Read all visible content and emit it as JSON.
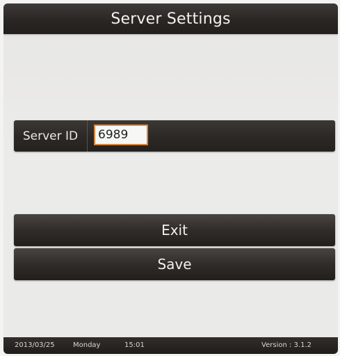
{
  "header": {
    "title": "Server Settings"
  },
  "server": {
    "label": "Server ID",
    "value": "6989"
  },
  "buttons": {
    "exit": "Exit",
    "save": "Save"
  },
  "status": {
    "date": "2013/03/25",
    "day": "Monday",
    "time": "15:01",
    "version": "Version : 3.1.2"
  },
  "colors": {
    "bar": "#2a2623",
    "background": "#e9e9e7",
    "input_border": "#d7853b"
  }
}
